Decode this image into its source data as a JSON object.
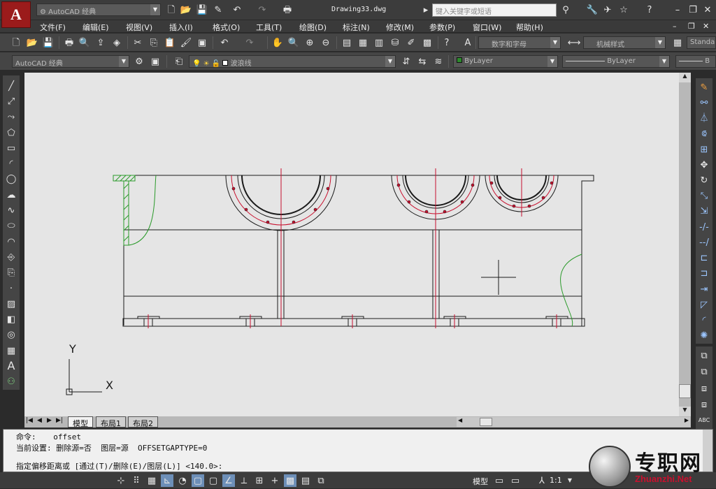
{
  "app": {
    "workspace": "AutoCAD 经典",
    "document_title": "Drawing33.dwg",
    "search_placeholder": "键入关键字或短语",
    "logo_letter": "A"
  },
  "menu": [
    "文件(F)",
    "编辑(E)",
    "视图(V)",
    "插入(I)",
    "格式(O)",
    "工具(T)",
    "绘图(D)",
    "标注(N)",
    "修改(M)",
    "参数(P)",
    "窗口(W)",
    "帮助(H)"
  ],
  "toolbar2": {
    "text_style": "数字和字母",
    "dim_style": "机械样式",
    "table_style": "Standa"
  },
  "toolbar3": {
    "workspace": "AutoCAD 经典",
    "layer": "波浪线",
    "color": "ByLayer",
    "linetype": "ByLayer",
    "lineweight": "B"
  },
  "layout_tabs": [
    "模型",
    "布局1",
    "布局2"
  ],
  "ucs": {
    "x": "X",
    "y": "Y"
  },
  "command": {
    "line1_label": "命令:",
    "line1_value": "offset",
    "line2": "当前设置: 删除源=否  图层=源  OFFSETGAPTYPE=0",
    "prompt": "指定偏移距离或 [通过(T)/删除(E)/图层(L)] <140.0>:"
  },
  "status": {
    "model": "模型",
    "scale": "1:1"
  },
  "watermark": {
    "text": "专职网",
    "url": "Zhuanzhi.Net"
  },
  "colors": {
    "accent_red": "#c8102e",
    "canvas": "#e5e5e5",
    "chrome": "#454545"
  }
}
